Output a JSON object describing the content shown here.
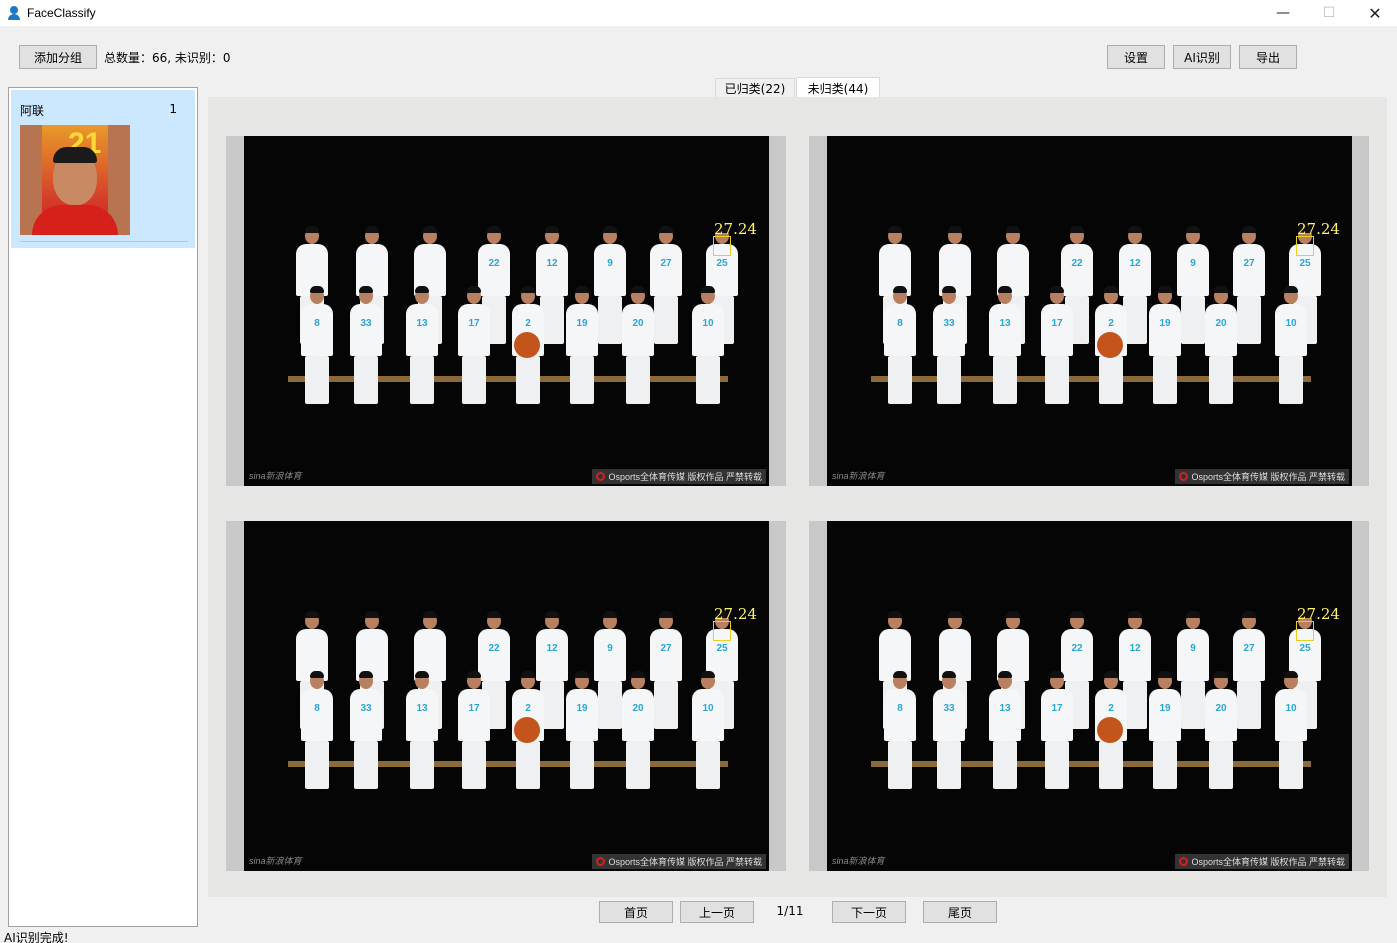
{
  "window": {
    "title": "FaceClassify",
    "minimize_symbol": "—",
    "maximize_symbol": "☐",
    "close_symbol": "✕"
  },
  "toolbar": {
    "add_group_label": "添加分组",
    "summary_text": "总数量：66, 未识别：0",
    "settings_label": "设置",
    "ai_recognize_label": "AI识别",
    "export_label": "导出"
  },
  "groups": [
    {
      "name": "阿联",
      "count": "1",
      "photo_number": "21"
    }
  ],
  "tabs": [
    {
      "label": "已归类(22)",
      "active": false
    },
    {
      "label": "未归类(44)",
      "active": true
    }
  ],
  "photos": [
    {
      "score": "27.24",
      "watermark_left": "sina新浪体育",
      "watermark_right": "Osports全体育传媒 版权作品 严禁转载"
    },
    {
      "score": "27.24",
      "watermark_left": "sina新浪体育",
      "watermark_right": "Osports全体育传媒 版权作品 严禁转载"
    },
    {
      "score": "27.24",
      "watermark_left": "sina新浪体育",
      "watermark_right": "Osports全体育传媒 版权作品 严禁转载"
    },
    {
      "score": "27.24",
      "watermark_left": "sina新浪体育",
      "watermark_right": "Osports全体育传媒 版权作品 严禁转载"
    }
  ],
  "jersey_numbers_back": [
    "",
    "",
    "",
    "22",
    "12",
    "9",
    "27",
    "25"
  ],
  "jersey_numbers_front": [
    "8",
    "33",
    "13",
    "17",
    "2",
    "19",
    "20",
    "10"
  ],
  "pagination": {
    "first_label": "首页",
    "prev_label": "上一页",
    "page_indicator": "1/11",
    "next_label": "下一页",
    "last_label": "尾页"
  },
  "status": {
    "message": "AI识别完成!"
  },
  "colors": {
    "selected_group_bg": "#cce8ff",
    "face_box": "#e8d020",
    "score_text": "#fff36a",
    "jersey_number": "#2aa6d6"
  }
}
